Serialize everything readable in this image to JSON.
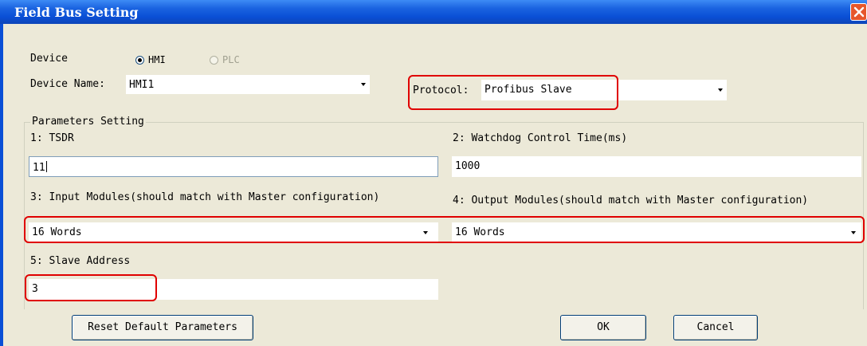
{
  "window": {
    "title": "Field Bus Setting"
  },
  "device": {
    "label": "Device",
    "options": [
      {
        "label": "HMI",
        "checked": true,
        "enabled": true
      },
      {
        "label": "PLC",
        "checked": false,
        "enabled": false
      }
    ]
  },
  "device_name": {
    "label": "Device Name:",
    "value": "HMI1"
  },
  "protocol": {
    "label": "Protocol:",
    "value": "Profibus Slave"
  },
  "parameters": {
    "group_label": "Parameters Setting",
    "tsdr": {
      "label": "1: TSDR",
      "value": "11"
    },
    "watchdog": {
      "label": "2: Watchdog Control Time(ms)",
      "value": "1000"
    },
    "input_modules": {
      "label": "3: Input Modules(should match with Master configuration)",
      "value": "16 Words"
    },
    "output_modules": {
      "label": "4: Output Modules(should match with Master configuration)",
      "value": "16 Words"
    },
    "slave_address": {
      "label": "5: Slave Address",
      "value": "3"
    }
  },
  "buttons": {
    "reset": "Reset Default Parameters",
    "ok": "OK",
    "cancel": "Cancel"
  },
  "colors": {
    "titlebar": "#0a4fd6",
    "highlight": "#e00000",
    "dialog_bg": "#ece9d8"
  }
}
